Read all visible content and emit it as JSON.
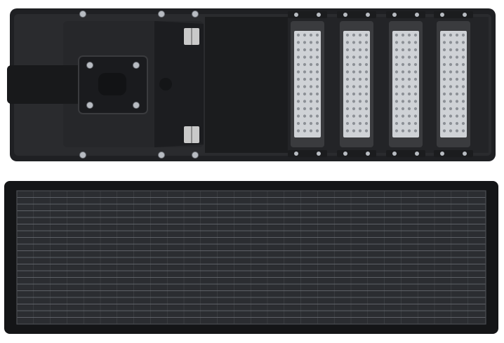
{
  "image": {
    "background": "#ffffff",
    "colors": {
      "housing": "#2a2b2e",
      "housing_edge": "#1a1b1d",
      "housing_inner": "#232427",
      "bracket": "#1f2023",
      "hinge": "#c9c9c9",
      "bolt": "#b8bcc2",
      "panel_frame": "#1b1c1e",
      "panel_cells": "#2b2d31",
      "panel_gridline": "#6b6f75",
      "led_frame": "#3a3b3e",
      "led_board": "#cfd2d6",
      "led_dot": "#8c9096"
    },
    "objects": [
      {
        "name": "lamp-housing-back-view"
      },
      {
        "name": "mounting-bracket"
      },
      {
        "name": "led-module-1"
      },
      {
        "name": "led-module-2"
      },
      {
        "name": "led-module-3"
      },
      {
        "name": "led-module-4"
      },
      {
        "name": "solar-panel-front-view"
      }
    ]
  }
}
